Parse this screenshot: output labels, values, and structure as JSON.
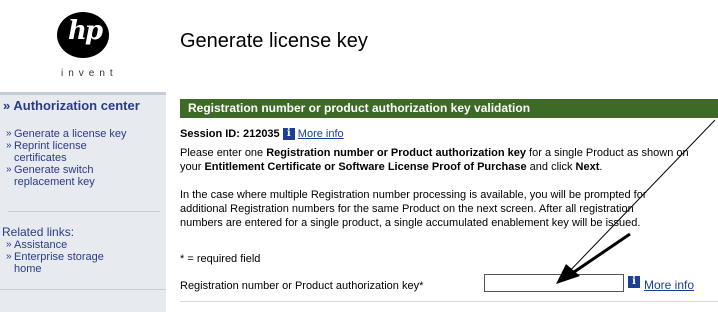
{
  "logo": {
    "mark": "hp",
    "tagline": "invent"
  },
  "page_title": "Generate license key",
  "sidebar": {
    "section_title": "» Authorization center",
    "items": [
      {
        "label": "Generate a license key",
        "lines": [
          "Generate a license key"
        ]
      },
      {
        "label": "Reprint license certificates",
        "lines": [
          "Reprint license",
          "certificates"
        ]
      },
      {
        "label": "Generate switch replacement key",
        "lines": [
          "Generate switch",
          "replacement key"
        ]
      }
    ],
    "related_title": "Related links:",
    "related_items": [
      {
        "label": "Assistance"
      },
      {
        "label": "Enterprise storage home",
        "lines": [
          "Enterprise storage",
          "home"
        ]
      }
    ]
  },
  "section_bar": "Registration number or product authorization key validation",
  "session": {
    "label": "Session ID: 212035",
    "info_icon": "i",
    "more_info": "More info"
  },
  "instructions": {
    "p1_pre": "Please enter one ",
    "p1_bold": "Registration number or Product authorization key",
    "p1_mid": " for a single Product as shown on",
    "p1_line2_pre": "your ",
    "p1_bold2": "Entitlement Certificate or Software License Proof of Purchase",
    "p1_mid2": " and click ",
    "p1_bold3": "Next",
    "p1_end": ".",
    "p2_l1": "In the case where multiple Registration number processing is available, you will be prompted for",
    "p2_l2": "additional Registration numbers for the same Product on the next screen. After all registration",
    "p2_l3": "numbers are entered for a single product, a single accumulated enablement key will be issued.",
    "required_note": "* = required field"
  },
  "form": {
    "field_label": "Registration number or Product authorization key*",
    "field_value": "",
    "info_icon": "i",
    "more_info": "More info"
  },
  "colors": {
    "nav_bg": "#e7ebef",
    "nav_text": "#2a3a89",
    "bar_bg": "#3d6a27",
    "link": "#1b3f94"
  }
}
